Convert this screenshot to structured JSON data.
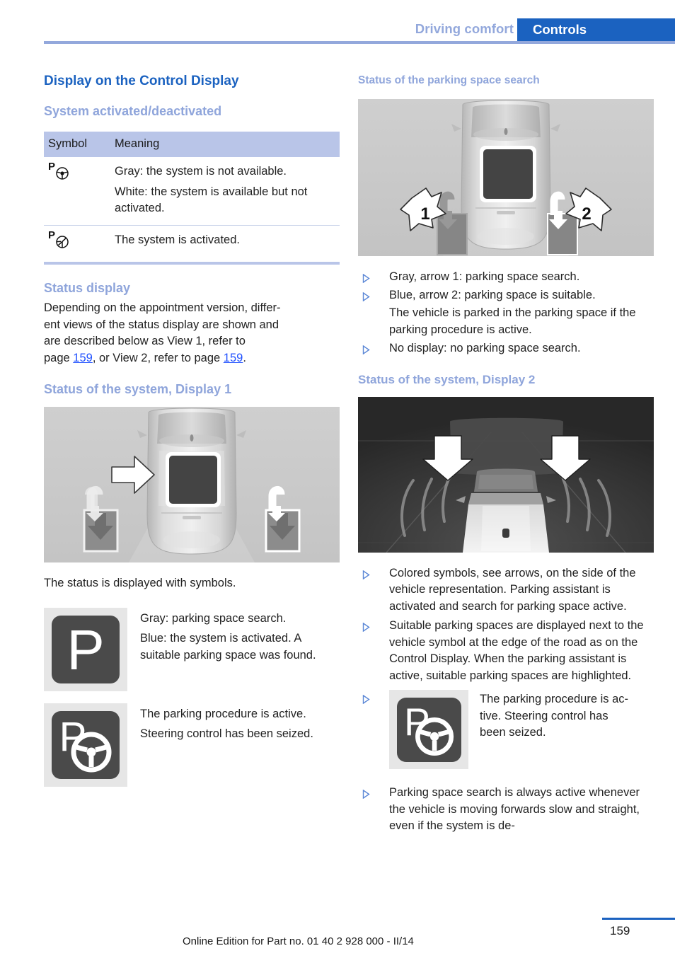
{
  "header": {
    "chapter": "Driving comfort",
    "tab": "Controls"
  },
  "left": {
    "title": "Display on the Control Display",
    "section_system": "System activated/deactivated",
    "table": {
      "columns": [
        "Symbol",
        "Meaning"
      ],
      "rows": [
        {
          "symbol_icon": "p-steering-wheel-icon",
          "symbol_label": "P",
          "lines": [
            "Gray: the system is not available.",
            "White: the system is available but not activated."
          ]
        },
        {
          "symbol_icon": "p-steering-wheel-slashed-icon",
          "symbol_label": "P",
          "lines": [
            "The system is activated."
          ]
        }
      ]
    },
    "section_status": "Status display",
    "status_text_1": "Depending on the appointment version, differ-",
    "status_text_2": "ent views of the status display are shown and",
    "status_text_3": "are described below as View 1, refer to",
    "status_text_4a": "page ",
    "status_link_1": "159",
    "status_text_4b": ", or View 2, refer to page ",
    "status_link_2": "159",
    "status_text_4c": ".",
    "section_display1": "Status of the system, Display 1",
    "figure1_alt": "top-down-vehicle-parking-spaces-figure",
    "caption": "The status is displayed with symbols.",
    "symbols": [
      {
        "icon": "parking-p-icon",
        "glyph": "P",
        "lines": [
          "Gray: parking space search.",
          "Blue: the system is activated. A suitable parking space was found."
        ]
      },
      {
        "icon": "parking-p-steering-wheel-icon",
        "glyph": "P",
        "lines": [
          "The parking procedure is active.",
          "Steering control has been seized."
        ]
      }
    ]
  },
  "right": {
    "section_parking_search": "Status of the parking space search",
    "figure2_alt": "top-down-vehicle-with-callouts-figure",
    "callouts": [
      "1",
      "2"
    ],
    "bullets_1": [
      {
        "text": "Gray, arrow 1: parking space search."
      },
      {
        "text": "Blue, arrow 2: parking space is suitable."
      },
      {
        "text": "The vehicle is parked in the parking space if the parking procedure is active.",
        "continuation": true
      },
      {
        "text": "No display: no parking space search."
      }
    ],
    "section_display2": "Status of the system, Display 2",
    "figure3_alt": "night-perspective-vehicle-arrows-figure",
    "bullets_2": [
      {
        "text": "Colored symbols, see arrows, on the side of the vehicle representation. Parking assistant is activated and search for parking space active."
      },
      {
        "text": "Suitable parking spaces are displayed next to the vehicle symbol at the edge of the road as on the Control Display. When the parking assistant is active, suitable parking spaces are highlighted."
      }
    ],
    "icon_bullet": {
      "icon": "parking-p-steering-wheel-icon",
      "glyph": "P",
      "text": "The parking procedure is ac-tive. Steering control has been seized.",
      "line1": "The parking procedure is ac-",
      "line2": "tive. Steering control has",
      "line3": "been seized."
    },
    "bullets_3": [
      {
        "text": "Parking space search is always active whenever the vehicle is moving forwards slow and straight, even if the system is de-"
      }
    ]
  },
  "footer": {
    "edition": "Online Edition for Part no. 01 40 2 928 000 - II/14",
    "page_number": "159"
  },
  "colors": {
    "accent_blue": "#1b62c0",
    "light_blue": "#8fa5db",
    "table_header": "#b9c5e8",
    "link_blue": "#2051ff"
  }
}
